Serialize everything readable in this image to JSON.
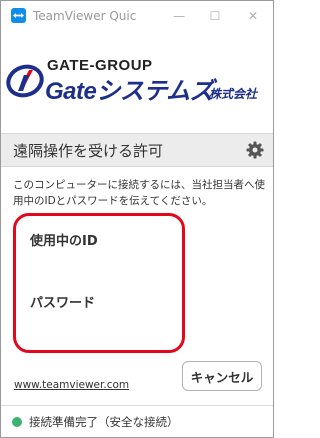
{
  "window": {
    "title": "TeamViewer Quic",
    "minimize_glyph": "—",
    "maximize_glyph": "☐",
    "close_glyph": "✕"
  },
  "logo": {
    "group": "GATE-GROUP",
    "name": "Gateシステムズ",
    "suffix": "株式会社",
    "brand_color": "#1d2f8a"
  },
  "section": {
    "title": "遠隔操作を受ける許可",
    "settings_icon": "gear-icon"
  },
  "description": "このコンピューターに接続するには、当社担当者へ使用中のIDとパスワードを伝えてください。",
  "credentials": {
    "id_label": "使用中のID",
    "password_label": "パスワード",
    "highlight_color": "#e2071b"
  },
  "footer": {
    "link": "www.teamviewer.com",
    "cancel_label": "キャンセル"
  },
  "status": {
    "text": "接続準備完了（安全な接続）",
    "color": "#3cb371"
  }
}
